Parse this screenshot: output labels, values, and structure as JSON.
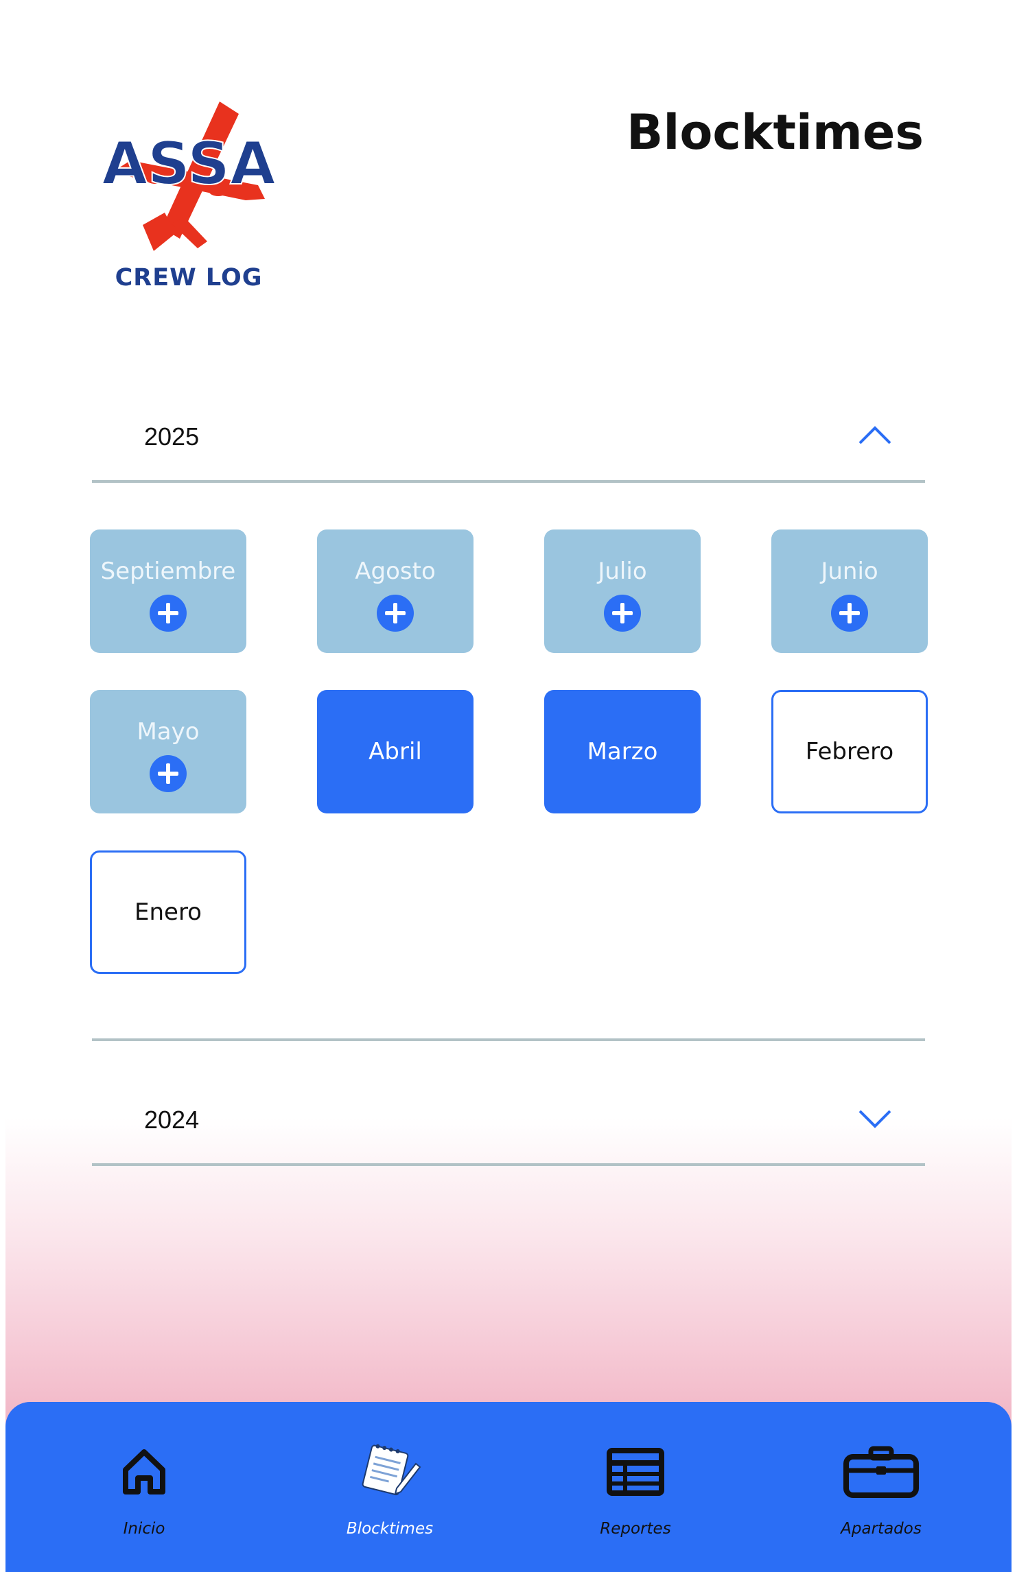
{
  "brand": {
    "logo_text": "ASSA",
    "caption": "CREW LOG"
  },
  "page": {
    "title": "Blocktimes"
  },
  "years": [
    {
      "label": "2025",
      "expanded": true,
      "chevron_icon": "chevron-up-icon"
    },
    {
      "label": "2024",
      "expanded": false,
      "chevron_icon": "chevron-down-icon"
    }
  ],
  "months": [
    {
      "label": "Septiembre",
      "state": "pending",
      "action_icon": "plus-circle-icon"
    },
    {
      "label": "Agosto",
      "state": "pending",
      "action_icon": "plus-circle-icon"
    },
    {
      "label": "Julio",
      "state": "pending",
      "action_icon": "plus-circle-icon"
    },
    {
      "label": "Junio",
      "state": "pending",
      "action_icon": "plus-circle-icon"
    },
    {
      "label": "Mayo",
      "state": "pending",
      "action_icon": "plus-circle-icon"
    },
    {
      "label": "Abril",
      "state": "filled"
    },
    {
      "label": "Marzo",
      "state": "filled"
    },
    {
      "label": "Febrero",
      "state": "outlined"
    },
    {
      "label": "Enero",
      "state": "outlined"
    }
  ],
  "nav": {
    "items": [
      {
        "label": "Inicio",
        "icon": "home-icon",
        "active": false
      },
      {
        "label": "Blocktimes",
        "icon": "notepad-pencil-icon",
        "active": true
      },
      {
        "label": "Reportes",
        "icon": "table-icon",
        "active": false
      },
      {
        "label": "Apartados",
        "icon": "briefcase-icon",
        "active": false
      }
    ]
  },
  "colors": {
    "accent": "#2b6ef5",
    "pending_tile": "#9ac5df",
    "logo_navy": "#1f3f8f",
    "logo_red": "#e8321e"
  }
}
